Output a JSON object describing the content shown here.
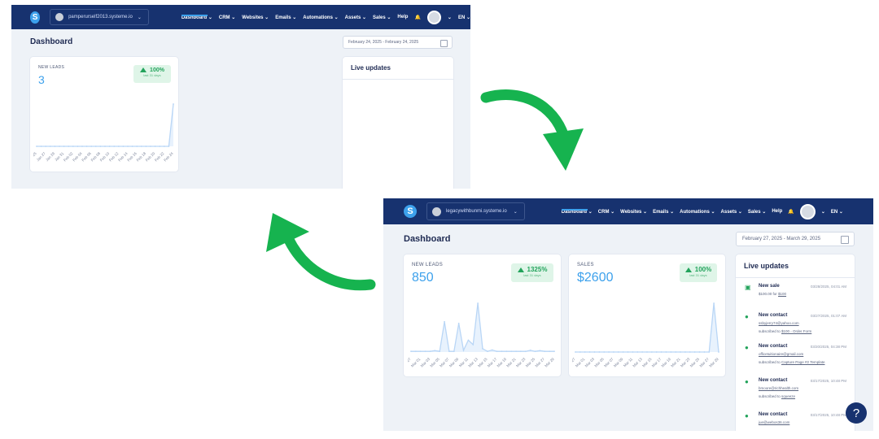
{
  "before": {
    "nav": {
      "logo": "S",
      "account": "pamperurself2013.systeme.io",
      "menu": [
        "Dashboard",
        "CRM",
        "Websites",
        "Emails",
        "Automations",
        "Assets",
        "Sales",
        "Help"
      ],
      "lang": "EN"
    },
    "title": "Dashboard",
    "date_range": "February 24, 2025 - February 24, 2025",
    "leads": {
      "label": "NEW LEADS",
      "value": "3",
      "badge_pct": "100%",
      "badge_sub": "last 31 days",
      "ticks": [
        "Jan 25",
        "Jan 27",
        "Jan 29",
        "Jan 31",
        "Feb 02",
        "Feb 04",
        "Feb 06",
        "Feb 08",
        "Feb 10",
        "Feb 12",
        "Feb 14",
        "Feb 16",
        "Feb 18",
        "Feb 20",
        "Feb 22",
        "Feb 24"
      ],
      "series": [
        0,
        0,
        0,
        0,
        0,
        0,
        0,
        0,
        0,
        0,
        0,
        0,
        0,
        0,
        0,
        0,
        0,
        0,
        0,
        0,
        0,
        0,
        0,
        0,
        0,
        0,
        0,
        0,
        0,
        0,
        3
      ]
    },
    "live": {
      "title": "Live updates"
    }
  },
  "after": {
    "nav": {
      "logo": "S",
      "account": "legacywithbunmi.systeme.io",
      "menu": [
        "Dashboard",
        "CRM",
        "Websites",
        "Emails",
        "Automations",
        "Assets",
        "Sales",
        "Help"
      ],
      "lang": "EN"
    },
    "title": "Dashboard",
    "date_range": "February 27, 2025 - March 29, 2025",
    "leads": {
      "label": "NEW LEADS",
      "value": "850",
      "badge_pct": "1325%",
      "badge_sub": "last 31 days",
      "ticks": [
        "Feb 27",
        "Mar 01",
        "Mar 03",
        "Mar 05",
        "Mar 07",
        "Mar 09",
        "Mar 11",
        "Mar 13",
        "Mar 15",
        "Mar 17",
        "Mar 19",
        "Mar 21",
        "Mar 23",
        "Mar 25",
        "Mar 27",
        "Mar 29"
      ],
      "series": [
        2,
        2,
        2,
        2,
        2,
        4,
        2,
        90,
        2,
        2,
        85,
        5,
        35,
        22,
        145,
        10,
        2,
        6,
        2,
        2,
        2,
        2,
        2,
        2,
        2,
        5,
        2,
        4,
        2,
        2,
        2
      ]
    },
    "sales": {
      "label": "SALES",
      "value": "$2600",
      "badge_pct": "100%",
      "badge_sub": "last 31 days",
      "ticks": [
        "Feb 27",
        "Mar 01",
        "Mar 03",
        "Mar 05",
        "Mar 07",
        "Mar 09",
        "Mar 11",
        "Mar 13",
        "Mar 15",
        "Mar 17",
        "Mar 19",
        "Mar 21",
        "Mar 23",
        "Mar 25",
        "Mar 27",
        "Mar 29"
      ],
      "series": [
        0,
        0,
        0,
        0,
        0,
        0,
        0,
        0,
        0,
        0,
        0,
        0,
        0,
        0,
        0,
        0,
        0,
        0,
        0,
        0,
        0,
        0,
        0,
        0,
        0,
        0,
        0,
        0,
        0,
        2600,
        0
      ]
    },
    "live": {
      "title": "Live updates",
      "items": [
        {
          "icon": "money-icon",
          "title": "New sale",
          "time": "03/28/2025, 04:01 AM",
          "line1_prefix": "$100.00 for ",
          "line1_link": "$100",
          "line2_prefix": "",
          "line2_link": ""
        },
        {
          "icon": "person-icon",
          "title": "New contact",
          "time": "03/27/2025, 01:07 AM",
          "line1_prefix": "",
          "line1_link": "ssbyjerry74@yahoo.com",
          "line2_prefix": "subscribed to ",
          "line2_link": "$100 - Order Form"
        },
        {
          "icon": "person-icon",
          "title": "New contact",
          "time": "03/20/2025, 04:38 PM",
          "line1_prefix": "",
          "line1_link": "officetuitionaire@gmail.com",
          "line2_prefix": "subscribed to ",
          "line2_link": "Capture Page #2 Template"
        },
        {
          "icon": "person-icon",
          "title": "New contact",
          "time": "03/17/2025, 10:48 PM",
          "line1_prefix": "",
          "line1_link": "bmoore@richhealth.com",
          "line2_prefix": "subscribed to ",
          "line2_link": "squeeze"
        },
        {
          "icon": "person-icon",
          "title": "New contact",
          "time": "03/17/2025, 10:48 PM",
          "line1_prefix": "",
          "line1_link": "jue@webos36.com",
          "line2_prefix": "",
          "line2_link": ""
        }
      ]
    },
    "help": "?"
  },
  "colors": {
    "nav": "#17326f",
    "accent": "#3da1ec",
    "arrow": "#16b34f",
    "positive": "#22a35b"
  }
}
